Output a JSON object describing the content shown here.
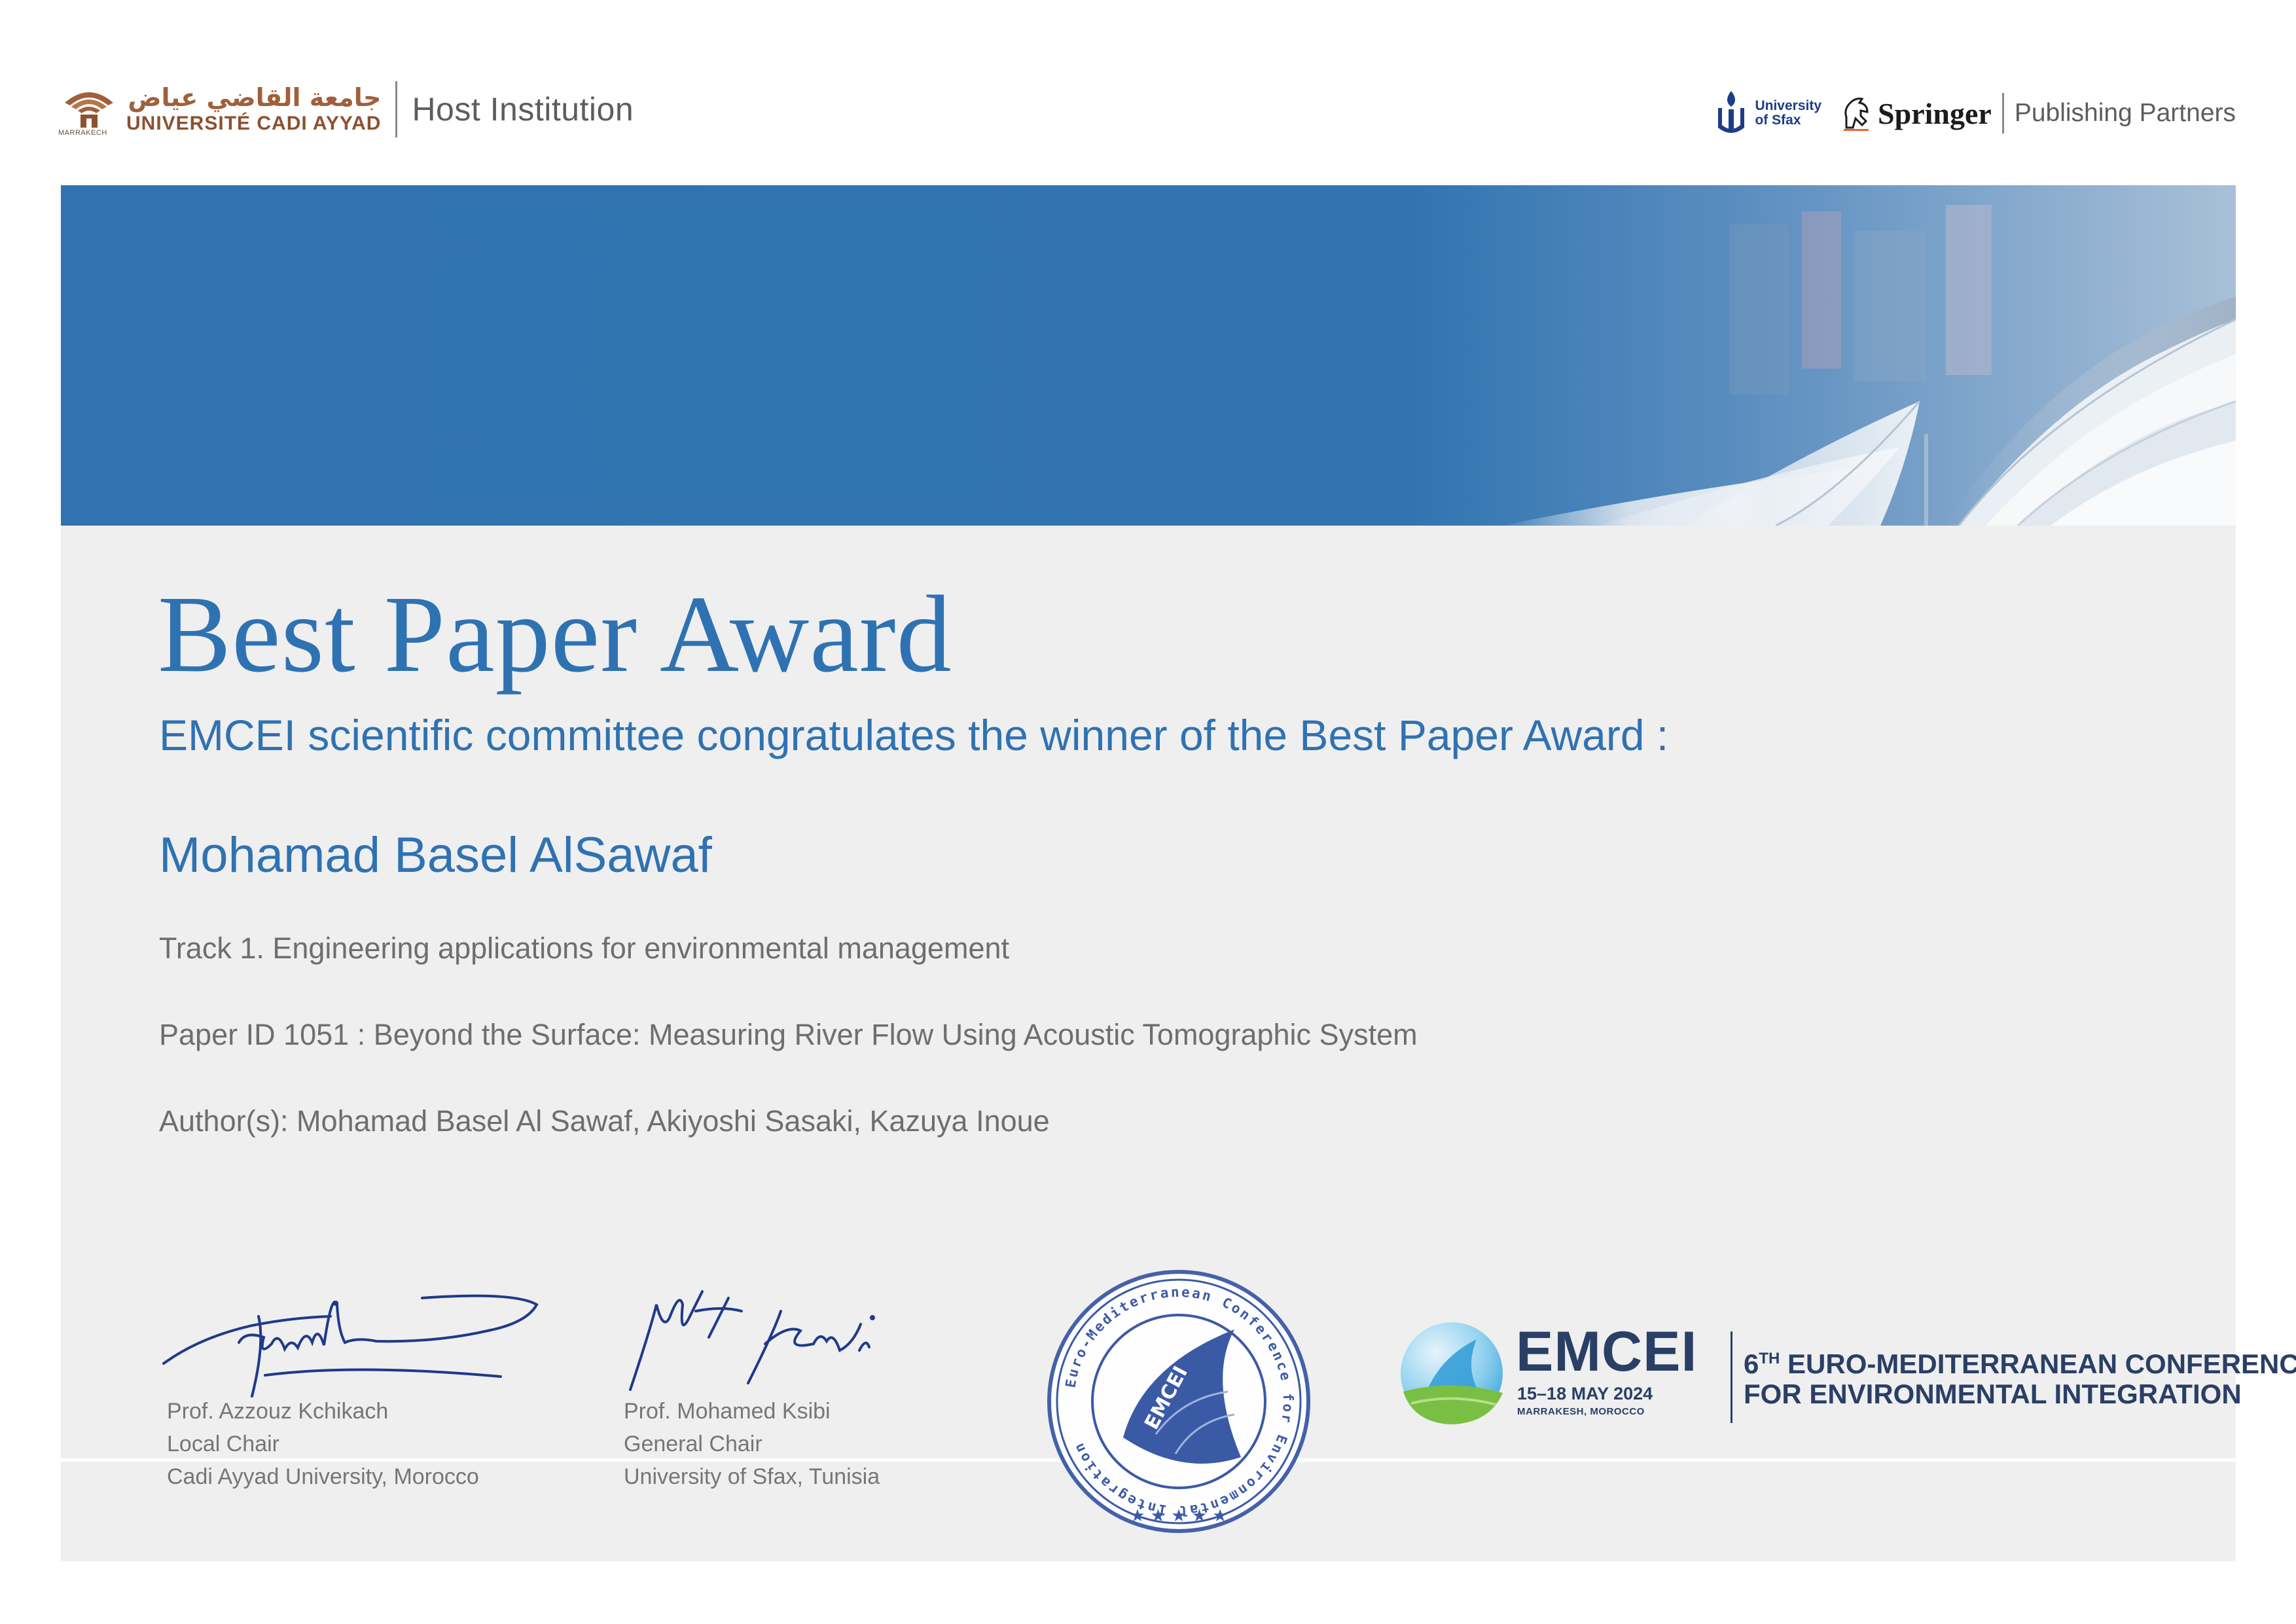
{
  "header": {
    "host_university_ar": "جامعة القاضي عياض",
    "host_university_fr": "UNIVERSITÉ CADI AYYAD",
    "host_city": "MARRAKECH",
    "host_label": "Host Institution",
    "partner_sfax_line1": "University",
    "partner_sfax_line2": "of Sfax",
    "partner_springer": "Springer",
    "partners_label": "Publishing Partners"
  },
  "colors": {
    "primary_blue": "#2f72b2",
    "banner_blue": "#3073b0",
    "panel_gray": "#efefef",
    "text_gray": "#6e6e6e",
    "navy": "#2a3f66"
  },
  "certificate": {
    "title": "Best Paper Award",
    "subtitle": "EMCEI scientific committee congratulates the winner of the Best Paper Award :",
    "winner": "Mohamad Basel AlSawaf",
    "track": "Track 1. Engineering applications for environmental management",
    "paper": "Paper ID 1051 :  Beyond the Surface: Measuring River Flow Using Acoustic Tomographic System",
    "authors": "Author(s): Mohamad Basel Al Sawaf, Akiyoshi Sasaki, Kazuya Inoue"
  },
  "signatories": [
    {
      "name": "Prof. Azzouz Kchikach",
      "role": "Local Chair",
      "affiliation": "Cadi Ayyad University, Morocco"
    },
    {
      "name": "Prof. Mohamed Ksibi",
      "role": "General Chair",
      "affiliation": "University of Sfax, Tunisia"
    }
  ],
  "seal": {
    "ring_text": "Euro-Mediterranean Conference for Environmental Integration",
    "center_text": "EMCEI"
  },
  "conference": {
    "acronym": "EMCEI",
    "dates": "15–18 MAY 2024",
    "place": "MARRAKESH, MOROCCO",
    "ordinal": "6",
    "ordinal_suffix": "TH",
    "line1_rest": " EURO-MEDITERRANEAN CONFERENCE",
    "line2": "FOR ENVIRONMENTAL INTEGRATION"
  }
}
